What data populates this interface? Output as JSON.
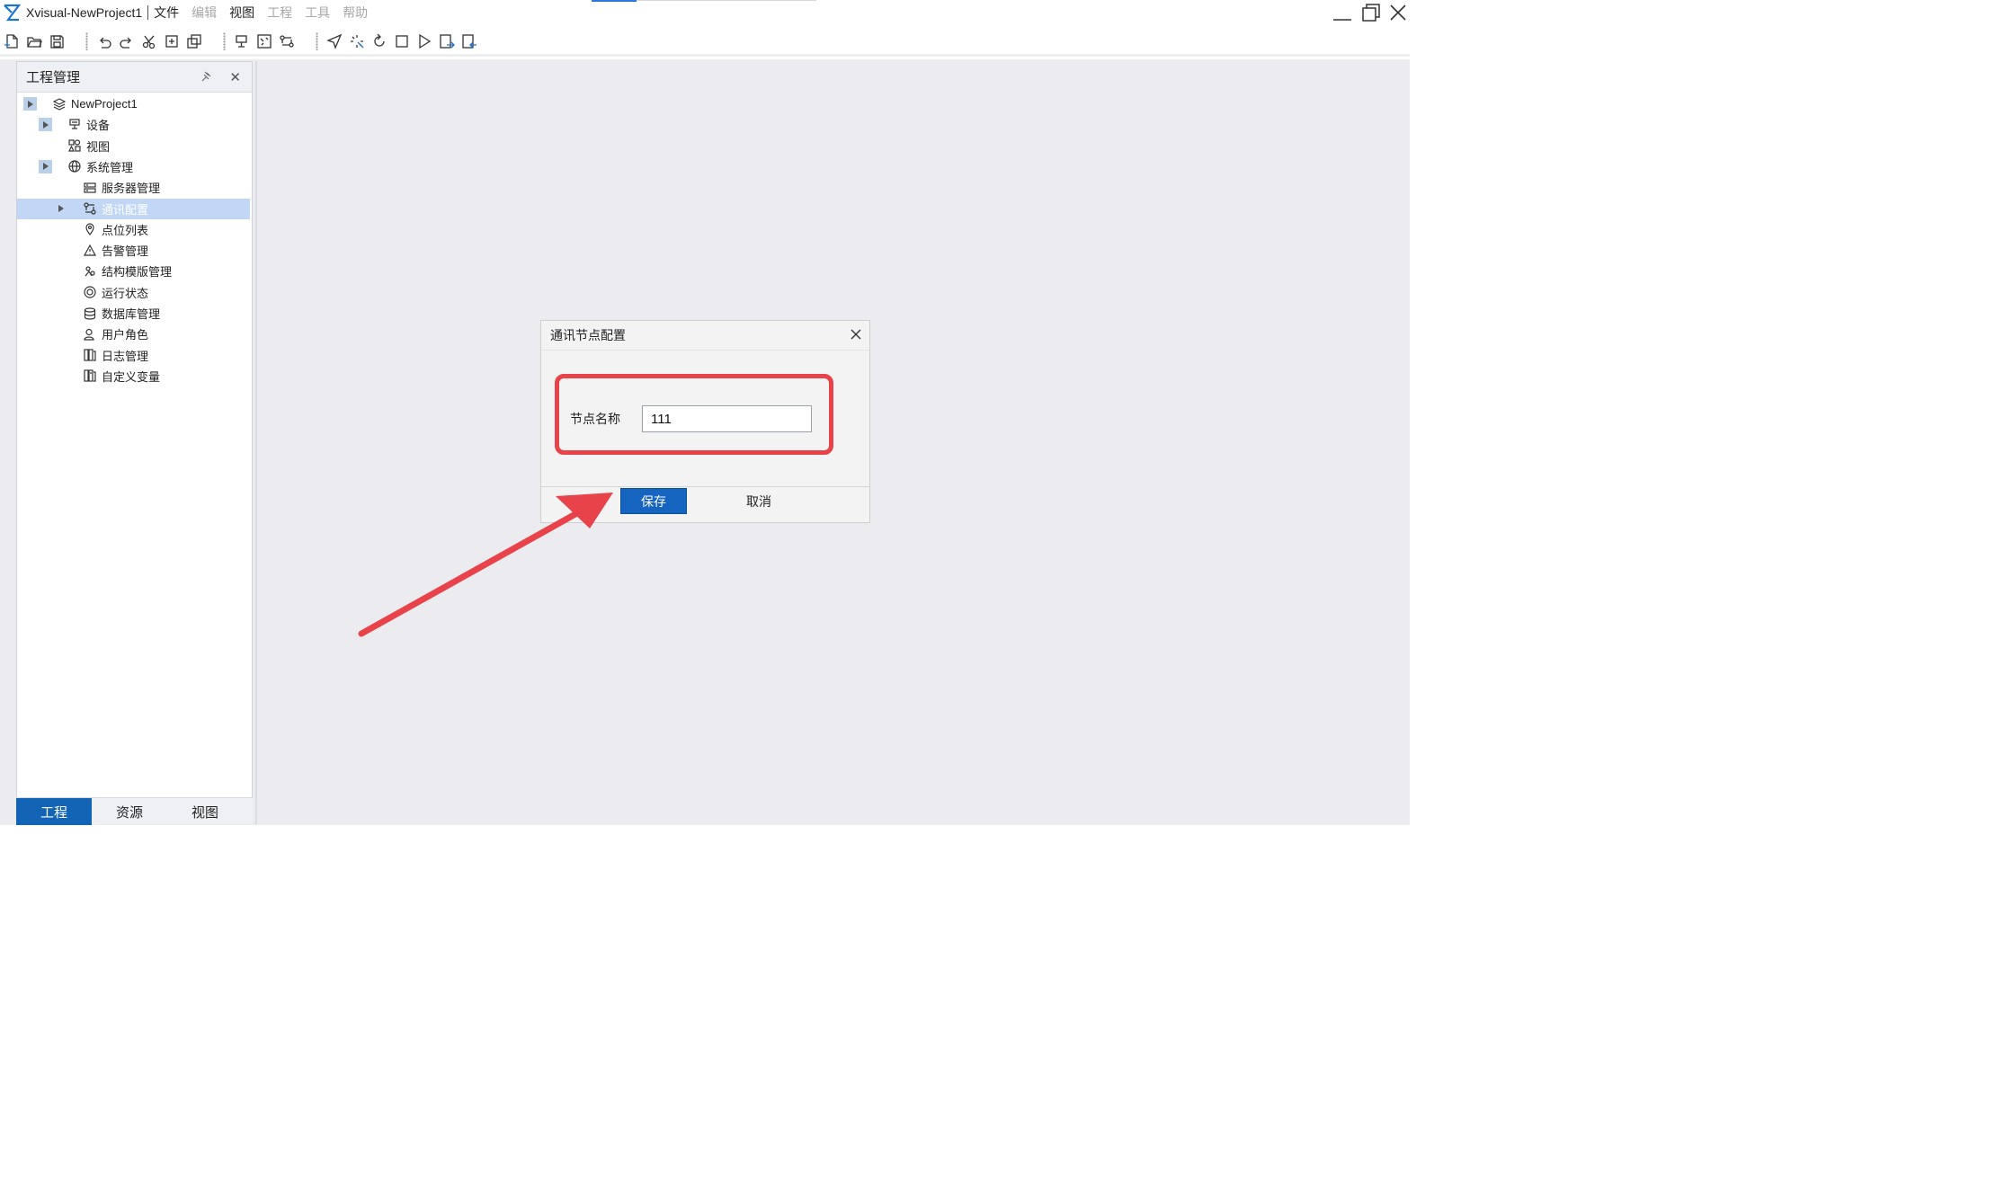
{
  "window": {
    "title": "Xvisual-NewProject1",
    "menu": [
      {
        "label": "文件",
        "enabled": true
      },
      {
        "label": "编辑",
        "enabled": false
      },
      {
        "label": "视图",
        "enabled": true
      },
      {
        "label": "工程",
        "enabled": false
      },
      {
        "label": "工具",
        "enabled": false
      },
      {
        "label": "帮助",
        "enabled": false
      }
    ]
  },
  "toolbar": {
    "groups": [
      [
        "new-file-icon",
        "open-folder-icon",
        "save-icon"
      ],
      [
        "undo-icon",
        "redo-icon",
        "cut-icon",
        "copy-add-icon",
        "copy-icon"
      ],
      [
        "device-add-icon",
        "view-add-icon",
        "comm-add-icon"
      ],
      [
        "send-icon",
        "compile-icon",
        "refresh-icon",
        "stop-icon",
        "run-icon",
        "export-icon",
        "import-icon"
      ]
    ]
  },
  "project_panel": {
    "title": "工程管理",
    "tree": [
      {
        "label": "NewProject1",
        "icon": "layers-icon",
        "level": 0,
        "expander": true
      },
      {
        "label": "设备",
        "icon": "device-icon",
        "level": 1,
        "expander": true
      },
      {
        "label": "视图",
        "icon": "view-icon",
        "level": 1,
        "expander": false
      },
      {
        "label": "系统管理",
        "icon": "globe-icon",
        "level": 1,
        "expander": true
      },
      {
        "label": "服务器管理",
        "icon": "server-icon",
        "level": 2,
        "expander": false
      },
      {
        "label": "通讯配置",
        "icon": "comm-icon",
        "level": 2,
        "expander": "arrow",
        "selected": true
      },
      {
        "label": "点位列表",
        "icon": "pin-icon",
        "level": 2,
        "expander": false
      },
      {
        "label": "告警管理",
        "icon": "alarm-icon",
        "level": 2,
        "expander": false
      },
      {
        "label": "结构模版管理",
        "icon": "template-icon",
        "level": 2,
        "expander": false
      },
      {
        "label": "运行状态",
        "icon": "status-icon",
        "level": 2,
        "expander": false
      },
      {
        "label": "数据库管理",
        "icon": "database-icon",
        "level": 2,
        "expander": false
      },
      {
        "label": "用户角色",
        "icon": "user-icon",
        "level": 2,
        "expander": false
      },
      {
        "label": "日志管理",
        "icon": "log-icon",
        "level": 2,
        "expander": false
      },
      {
        "label": "自定义变量",
        "icon": "variable-icon",
        "level": 2,
        "expander": false
      }
    ],
    "tabs": [
      {
        "label": "工程",
        "active": true
      },
      {
        "label": "资源",
        "active": false
      },
      {
        "label": "视图",
        "active": false
      }
    ]
  },
  "dialog": {
    "title": "通讯节点配置",
    "field_label": "节点名称",
    "field_value": "111",
    "save_label": "保存",
    "cancel_label": "取消"
  },
  "colors": {
    "accent": "#1565c0",
    "selection": "#c2d6f5",
    "annotation": "#e8434a"
  }
}
